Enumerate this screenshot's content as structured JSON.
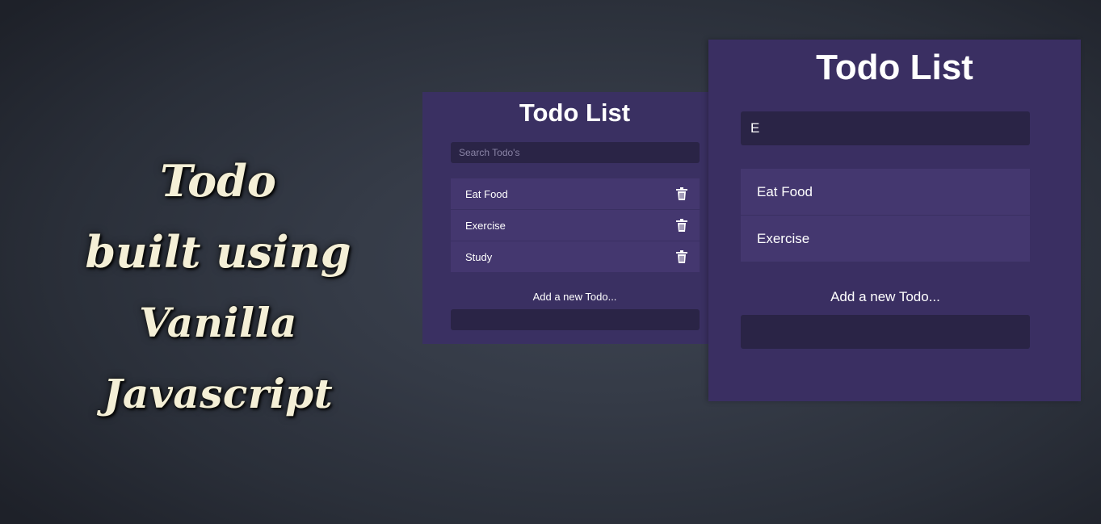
{
  "banner": {
    "line1": "Todo",
    "line2": "built using",
    "line3": "Vanilla Javascript"
  },
  "small_app": {
    "title": "Todo List",
    "search": {
      "placeholder": "Search Todo's",
      "value": ""
    },
    "items": [
      {
        "label": "Eat Food",
        "icon": "trash-icon"
      },
      {
        "label": "Exercise",
        "icon": "trash-icon"
      },
      {
        "label": "Study",
        "icon": "trash-icon"
      }
    ],
    "add_label": "Add a new Todo..."
  },
  "large_app": {
    "title": "Todo List",
    "search": {
      "value": "E"
    },
    "items": [
      {
        "label": "Eat Food"
      },
      {
        "label": "Exercise"
      }
    ],
    "add_label": "Add a new Todo..."
  },
  "colors": {
    "panel": "#3a3062",
    "item": "#44376f",
    "input": "#2a2446"
  }
}
